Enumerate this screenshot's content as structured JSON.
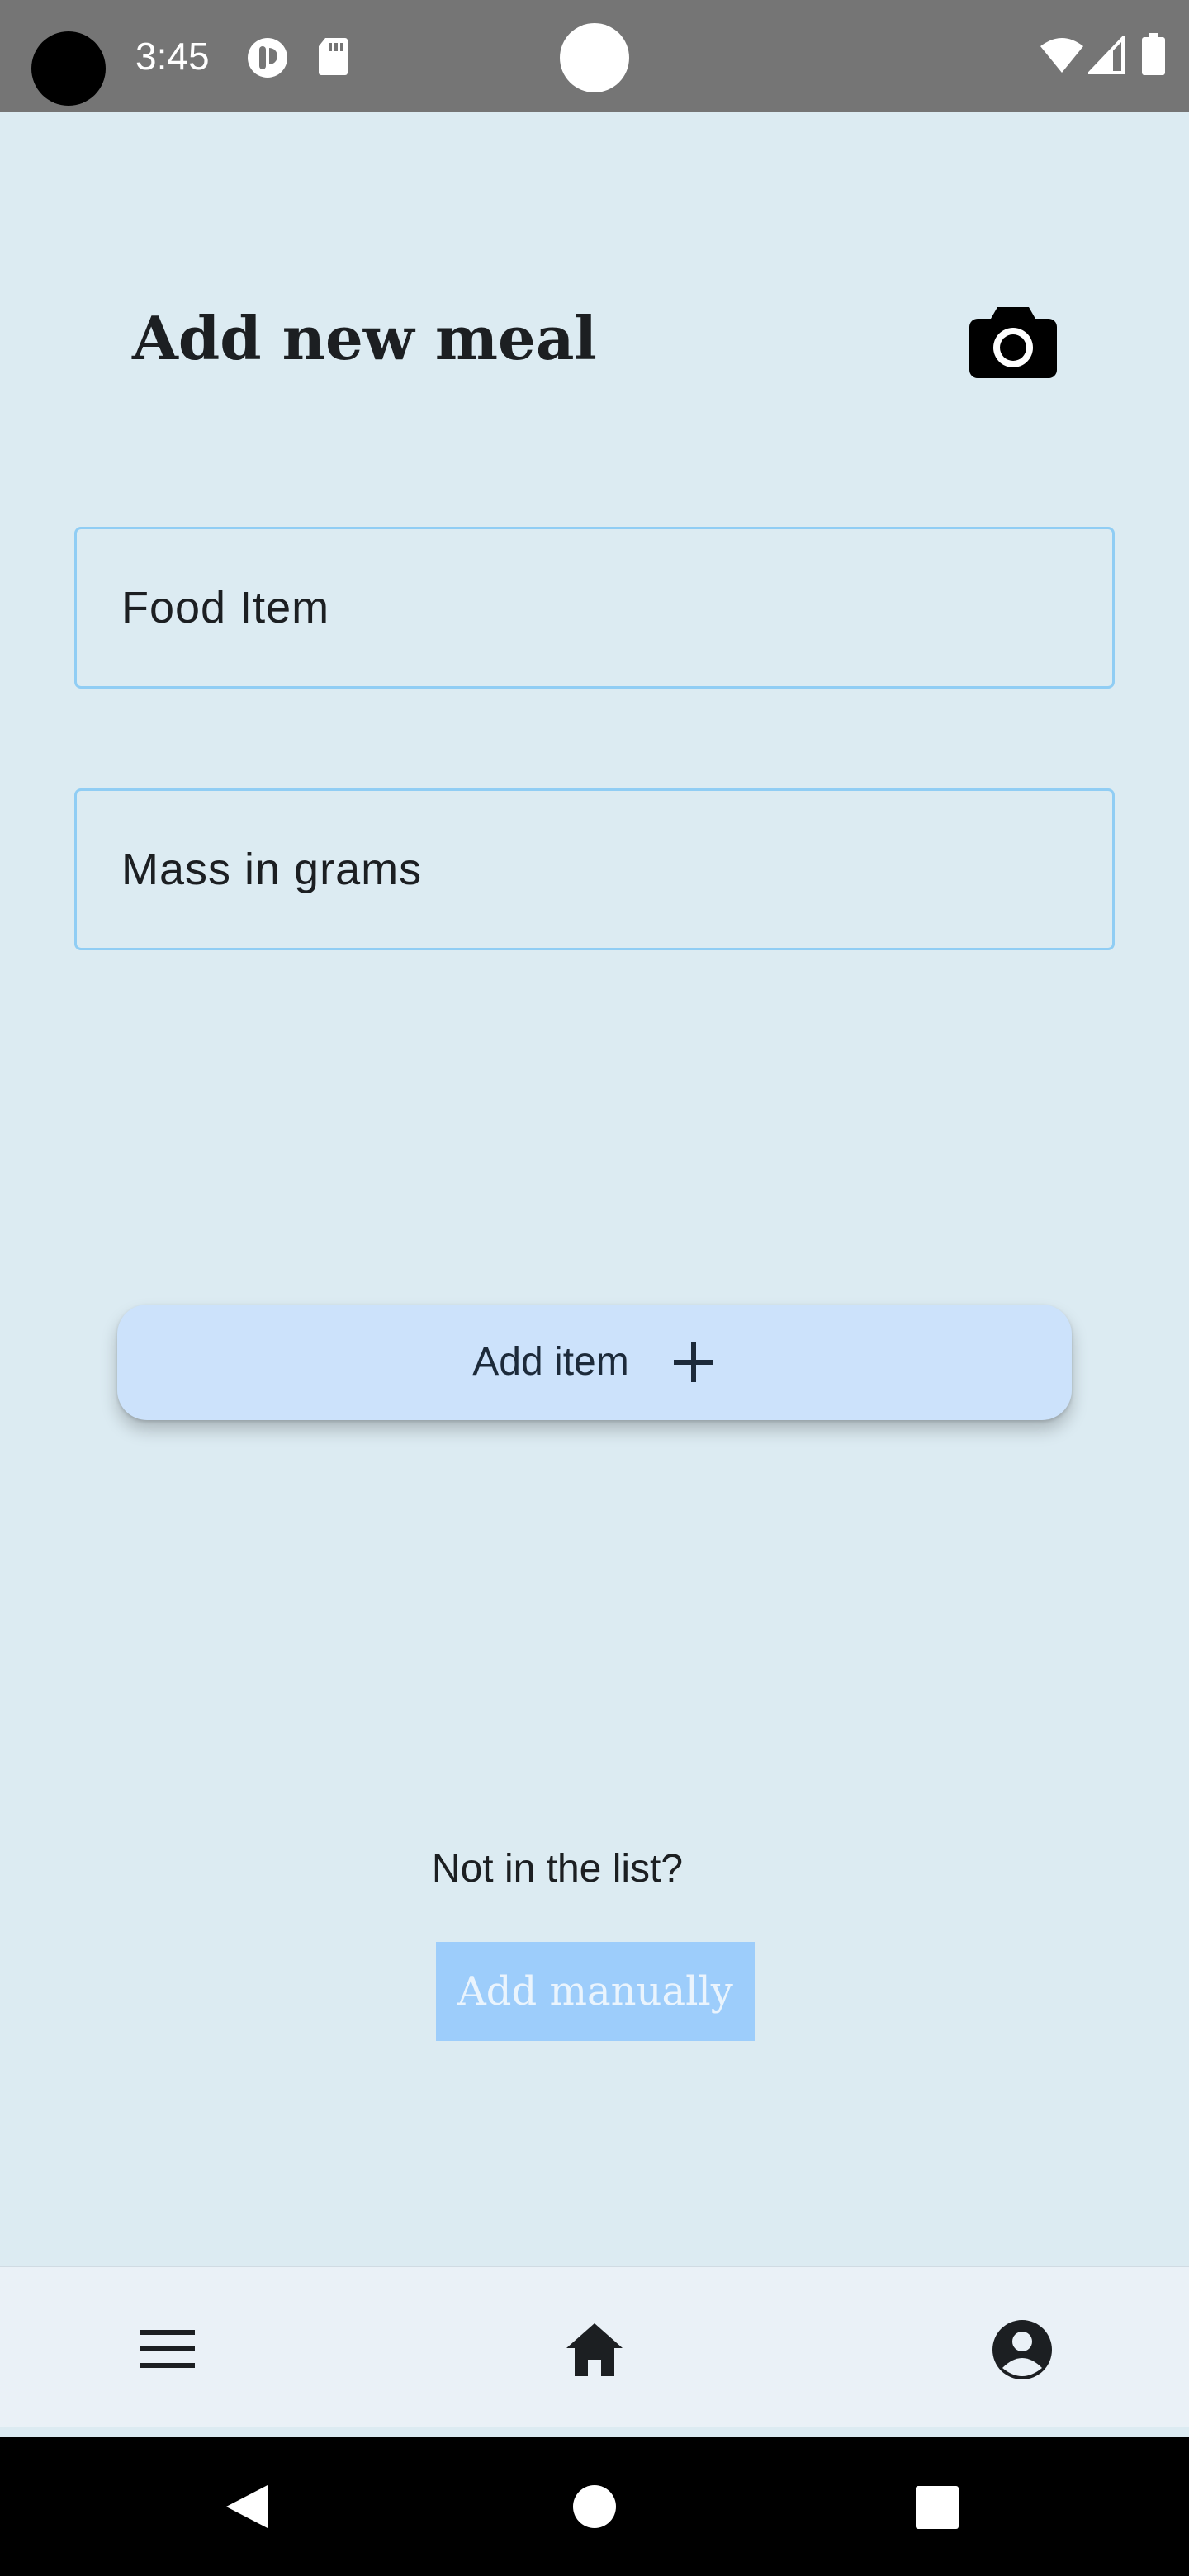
{
  "status_bar": {
    "time": "3:45"
  },
  "header": {
    "title": "Add new meal",
    "camera_icon": "camera-icon"
  },
  "form": {
    "food_item": {
      "placeholder": "Food Item",
      "value": ""
    },
    "mass": {
      "placeholder": "Mass in grams",
      "value": ""
    }
  },
  "actions": {
    "add_item_label": "Add item",
    "add_item_icon": "plus-icon"
  },
  "manual": {
    "prompt": "Not in the list?",
    "button_label": "Add manually"
  },
  "bottom_nav": {
    "items": [
      {
        "name": "menu",
        "icon": "hamburger-menu-icon"
      },
      {
        "name": "home",
        "icon": "home-icon"
      },
      {
        "name": "profile",
        "icon": "account-circle-icon"
      }
    ]
  },
  "system_nav": {
    "buttons": [
      "back-icon",
      "home-circle-icon",
      "recents-icon"
    ]
  },
  "colors": {
    "background": "#dcebf2",
    "field_border": "#90cdf4",
    "add_item_bg": "#cce2fb",
    "add_manually_bg": "#9dcdfb",
    "status_bar": "#757575"
  }
}
